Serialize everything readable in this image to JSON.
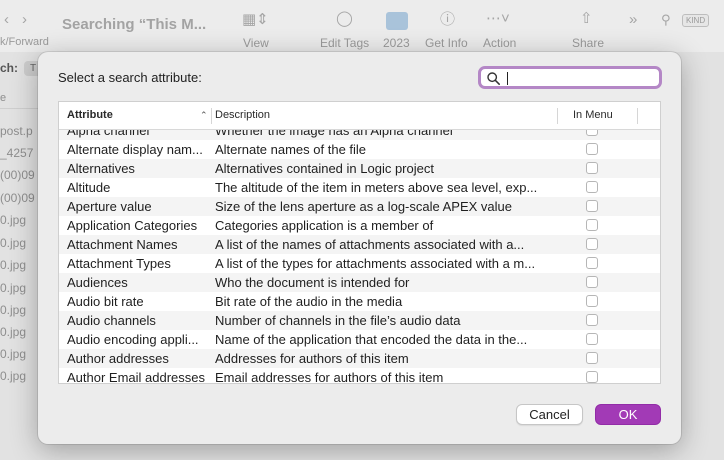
{
  "background": {
    "nav_label": "k/Forward",
    "window_title": "Searching “This M...",
    "toolbar": [
      {
        "label": "View",
        "icon": "view-icon"
      },
      {
        "label": "Edit Tags",
        "icon": "tag-icon"
      },
      {
        "label": "2023",
        "icon": "folder-icon"
      },
      {
        "label": "Get Info",
        "icon": "info-icon"
      },
      {
        "label": "Action",
        "icon": "action-icon"
      },
      {
        "label": "Share",
        "icon": "share-icon"
      }
    ],
    "kind_badge": "KIND",
    "search_label": "ch:",
    "scope_chip": "T",
    "column_fragment": "e",
    "files": [
      "post.p",
      "_4257",
      "(00)09",
      "(00)09",
      "0.jpg",
      "0.jpg",
      "0.jpg",
      "0.jpg",
      "0.jpg",
      "0.jpg",
      "0.jpg",
      "0.jpg",
      "0.jpg"
    ]
  },
  "dialog": {
    "prompt": "Select a search attribute:",
    "search": {
      "value": "",
      "placeholder": ""
    },
    "columns": {
      "attribute": "Attribute",
      "description": "Description",
      "in_menu": "In Menu"
    },
    "rows": [
      {
        "attribute": "Alpha channel",
        "description": "Whether the image has an Alpha channel",
        "in_menu": false
      },
      {
        "attribute": "Alternate display nam...",
        "description": "Alternate names of the file",
        "in_menu": false
      },
      {
        "attribute": "Alternatives",
        "description": "Alternatives contained in Logic project",
        "in_menu": false
      },
      {
        "attribute": "Altitude",
        "description": "The altitude of the item in meters above sea level, exp...",
        "in_menu": false
      },
      {
        "attribute": "Aperture value",
        "description": "Size of the lens aperture as a log-scale APEX value",
        "in_menu": false
      },
      {
        "attribute": "Application Categories",
        "description": "Categories application is a member of",
        "in_menu": false
      },
      {
        "attribute": "Attachment Names",
        "description": "A list of the names of attachments associated with a...",
        "in_menu": false
      },
      {
        "attribute": "Attachment Types",
        "description": "A list of the types for attachments associated with a m...",
        "in_menu": false
      },
      {
        "attribute": "Audiences",
        "description": "Who the document is intended for",
        "in_menu": false
      },
      {
        "attribute": "Audio bit rate",
        "description": "Bit rate of the audio in the media",
        "in_menu": false
      },
      {
        "attribute": "Audio channels",
        "description": "Number of channels in the file’s audio data",
        "in_menu": false
      },
      {
        "attribute": "Audio encoding appli...",
        "description": "Name of the application that encoded the data in the...",
        "in_menu": false
      },
      {
        "attribute": "Author addresses",
        "description": "Addresses for authors of this item",
        "in_menu": false
      },
      {
        "attribute": "Author Email addresses",
        "description": "Email addresses for authors of this item",
        "in_menu": false
      }
    ],
    "cancel_label": "Cancel",
    "ok_label": "OK"
  },
  "colors": {
    "accent": "#a23ab6",
    "focus_ring": "#b487c6"
  }
}
